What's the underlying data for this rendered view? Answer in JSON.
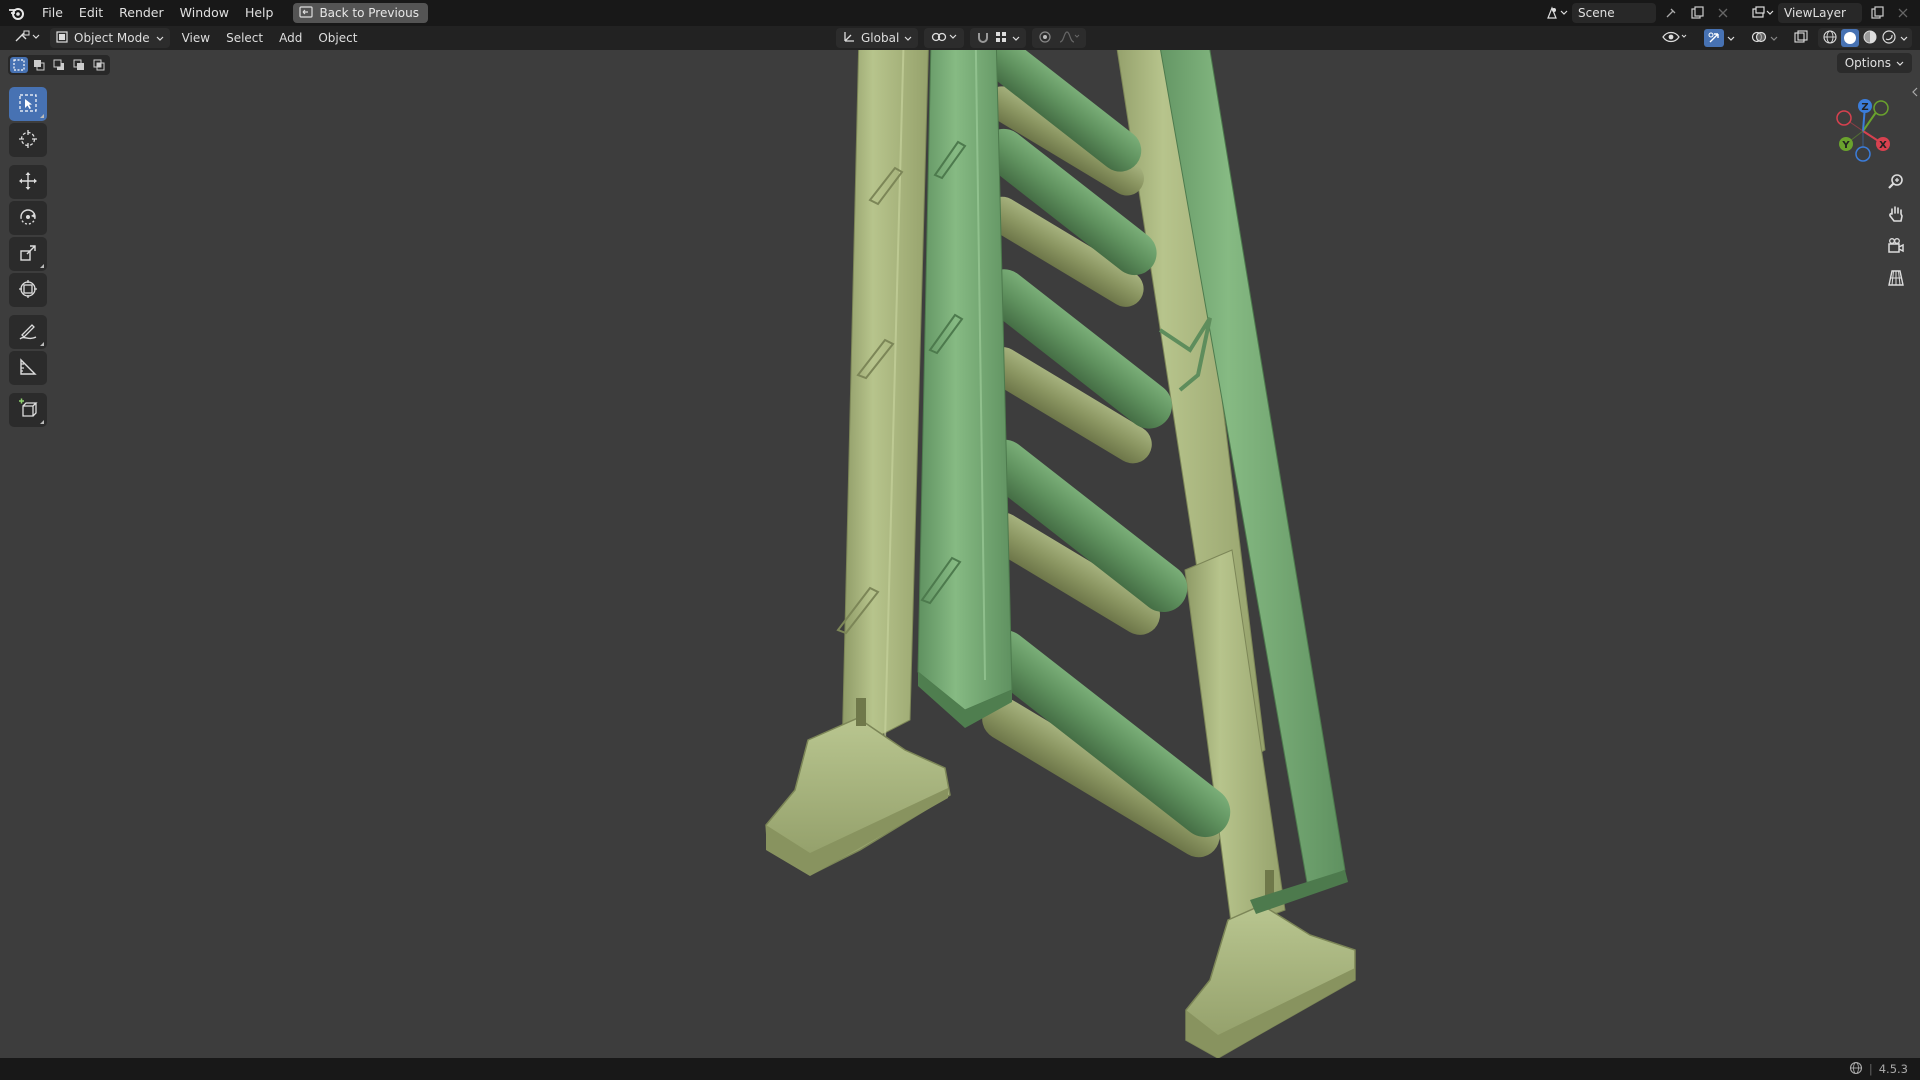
{
  "menu": {
    "items": [
      "File",
      "Edit",
      "Render",
      "Window",
      "Help"
    ],
    "back_button": "Back to Previous"
  },
  "topbar_right": {
    "scene_name": "Scene",
    "view_layer_name": "ViewLayer"
  },
  "viewport_header": {
    "mode": "Object Mode",
    "menus": [
      "View",
      "Select",
      "Add",
      "Object"
    ],
    "transform_orientation": "Global",
    "options_label": "Options"
  },
  "gizmo": {
    "axes": [
      "X",
      "Y",
      "Z"
    ],
    "colors": {
      "x": "#d8414f",
      "y": "#6aa22d",
      "z": "#3b7ddb"
    }
  },
  "status": {
    "version": "4.5.3"
  },
  "scene_colors": {
    "viewport_bg": "#3d3d3d",
    "ladder_back": "#a8b57e",
    "ladder_front": "#79ad76",
    "accent": "#4772b3"
  }
}
